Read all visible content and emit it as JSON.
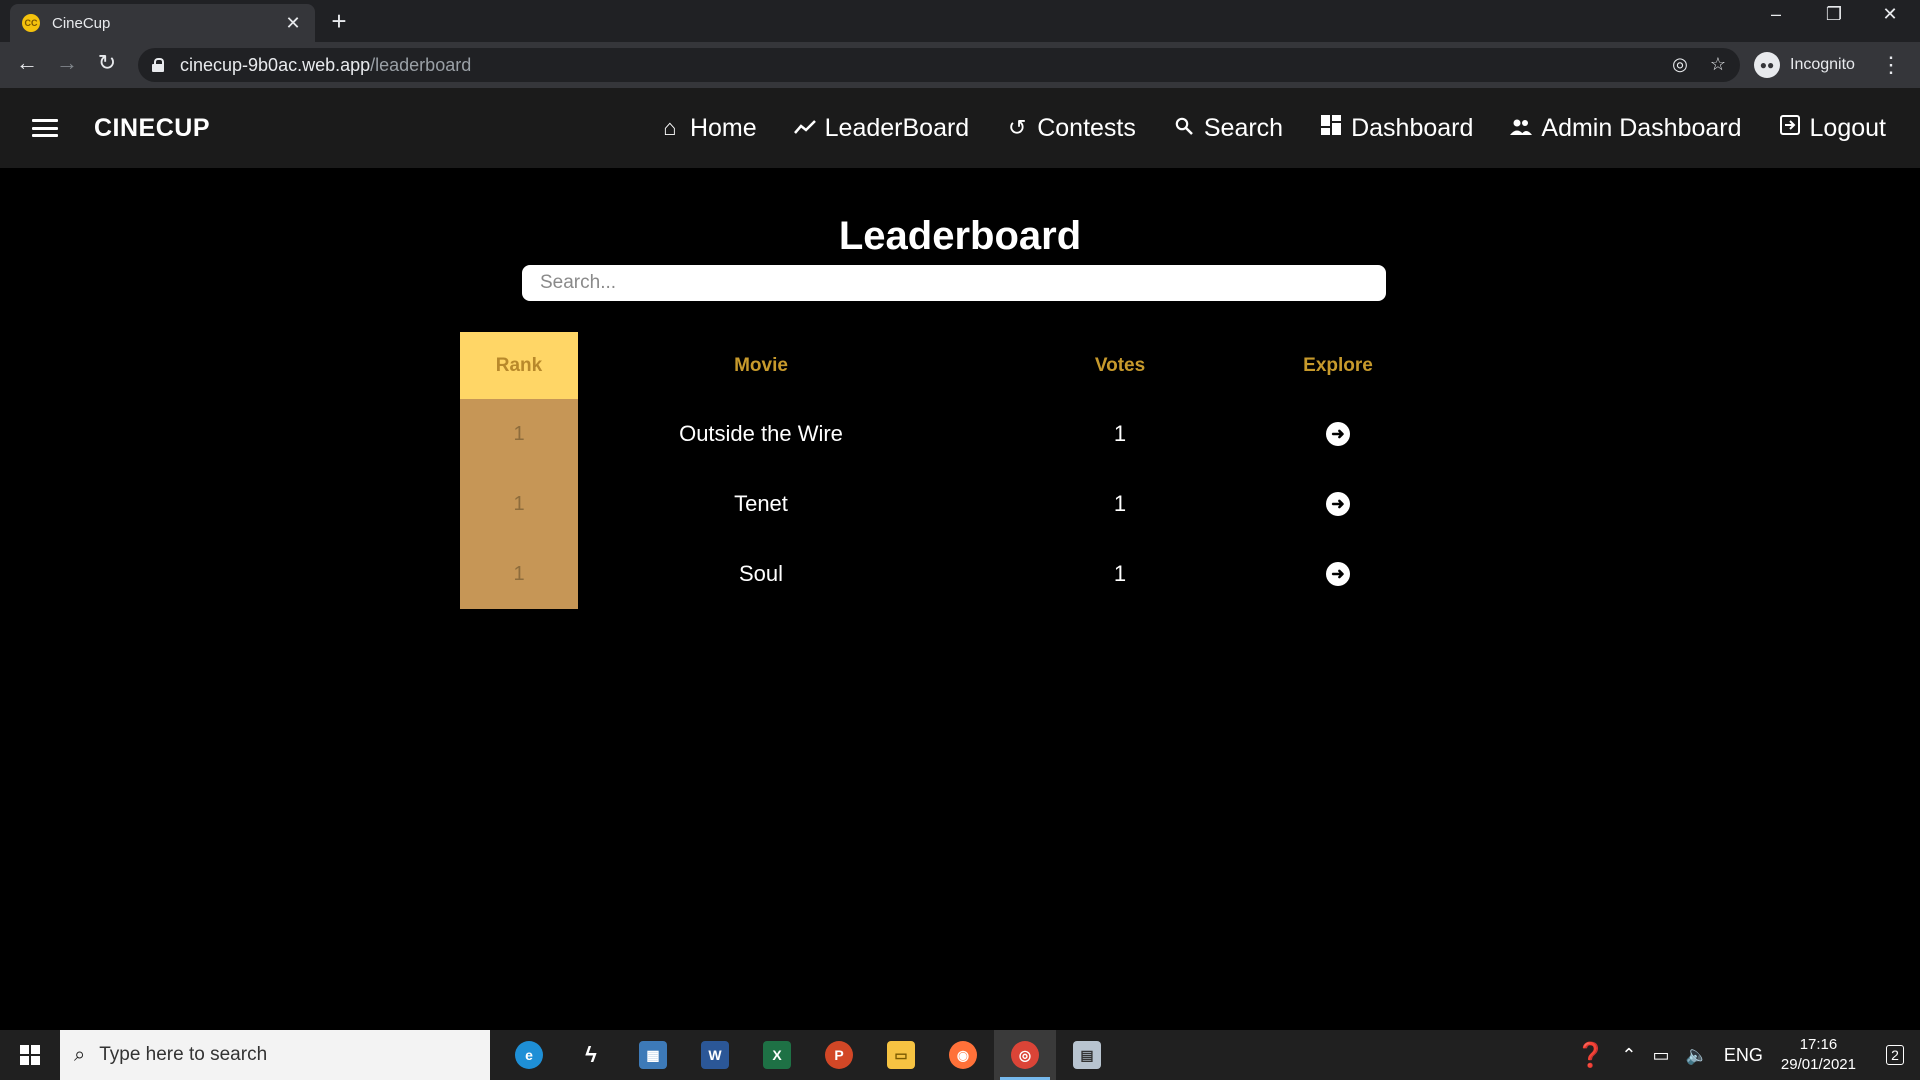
{
  "browser": {
    "tab_title": "CineCup",
    "tab_favicon_text": "CC",
    "tab_close": "✕",
    "new_tab": "+",
    "url_host": "cinecup-9b0ac.web.app",
    "url_path": "/leaderboard",
    "profile_label": "Incognito",
    "controls": {
      "minimize": "–",
      "restore": "❐",
      "close": "✕"
    }
  },
  "app": {
    "brand": "CINECUP",
    "nav": [
      {
        "label": "Home",
        "icon": "home-icon"
      },
      {
        "label": "LeaderBoard",
        "icon": "trending-icon"
      },
      {
        "label": "Contests",
        "icon": "history-icon"
      },
      {
        "label": "Search",
        "icon": "search-icon"
      },
      {
        "label": "Dashboard",
        "icon": "dashboard-icon"
      },
      {
        "label": "Admin Dashboard",
        "icon": "people-icon"
      },
      {
        "label": "Logout",
        "icon": "logout-icon"
      }
    ]
  },
  "leaderboard": {
    "title": "Leaderboard",
    "search_placeholder": "Search...",
    "columns": {
      "rank": "Rank",
      "movie": "Movie",
      "votes": "Votes",
      "explore": "Explore"
    },
    "rows": [
      {
        "rank": "1",
        "movie": "Outside the Wire",
        "votes": "1"
      },
      {
        "rank": "1",
        "movie": "Tenet",
        "votes": "1"
      },
      {
        "rank": "1",
        "movie": "Soul",
        "votes": "1"
      }
    ],
    "colors": {
      "header_rank_bg": "#ffd666",
      "rank_bg": "#c69656",
      "header_text": "#c79a2c"
    }
  },
  "taskbar": {
    "search_placeholder": "Type here to search",
    "apps": [
      "edge-icon",
      "sway-icon",
      "photo-app-icon",
      "word-icon",
      "excel-icon",
      "powerpoint-icon",
      "file-explorer-icon",
      "firefox-icon",
      "chrome-icon",
      "remote-app-icon"
    ],
    "language": "ENG",
    "time": "17:16",
    "date": "29/01/2021",
    "notification_count": "2"
  }
}
